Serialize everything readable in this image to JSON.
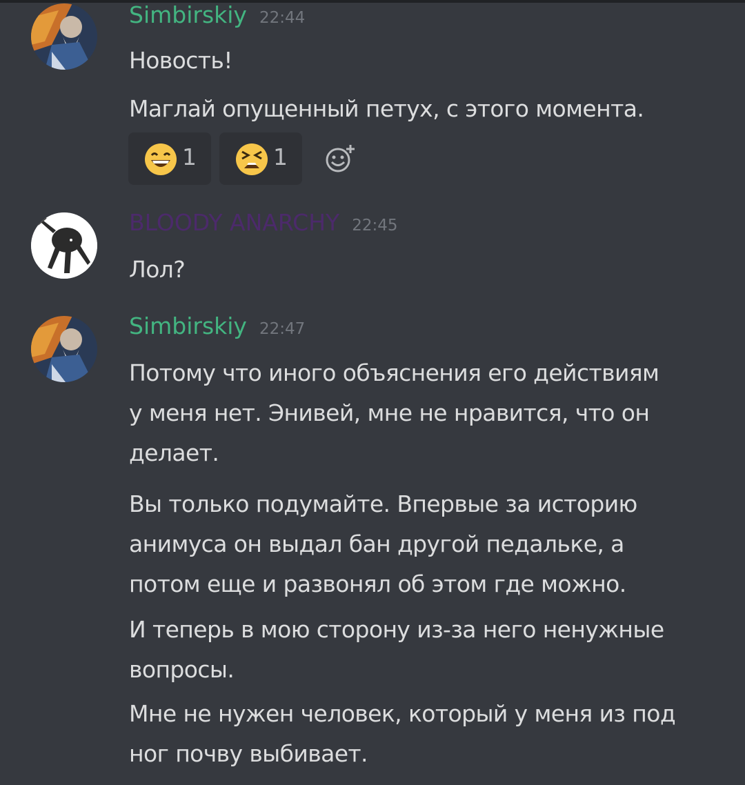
{
  "colors": {
    "background": "#36393f",
    "simbirskiy_name": "#43b581",
    "anarchy_name": "#4c2a6b",
    "timestamp": "#72767d",
    "text": "#dcddde"
  },
  "messages": [
    {
      "username": "Simbirskiy",
      "time": "22:44",
      "avatar": "old-man-avatar",
      "lines": [
        "Новость!",
        "Маглай опущенный петух, с этого момента."
      ],
      "reactions": [
        {
          "icon": "grinning-smile-emoji",
          "count": "1"
        },
        {
          "icon": "tired-face-emoji",
          "count": "1"
        }
      ],
      "add_reaction_icon": "add-reaction-icon"
    },
    {
      "username": "BLOODY ANARCHY",
      "time": "22:45",
      "avatar": "dark-creature-avatar",
      "lines": [
        "Лол?"
      ]
    },
    {
      "username": "Simbirskiy",
      "time": "22:47",
      "avatar": "old-man-avatar",
      "lines": [
        "Потому что иного объяснения его действиям",
        "у меня нет. Энивей, мне не нравится, что он",
        "делает.",
        "Вы только подумайте. Впервые за историю",
        "анимуса он выдал бан другой педальке, а",
        "потом еще и развонял об этом где можно.",
        "И теперь в мою сторону из-за него ненужные",
        "вопросы.",
        "Мне не нужен человек, который у меня из под",
        "ног почву выбивает."
      ]
    }
  ]
}
